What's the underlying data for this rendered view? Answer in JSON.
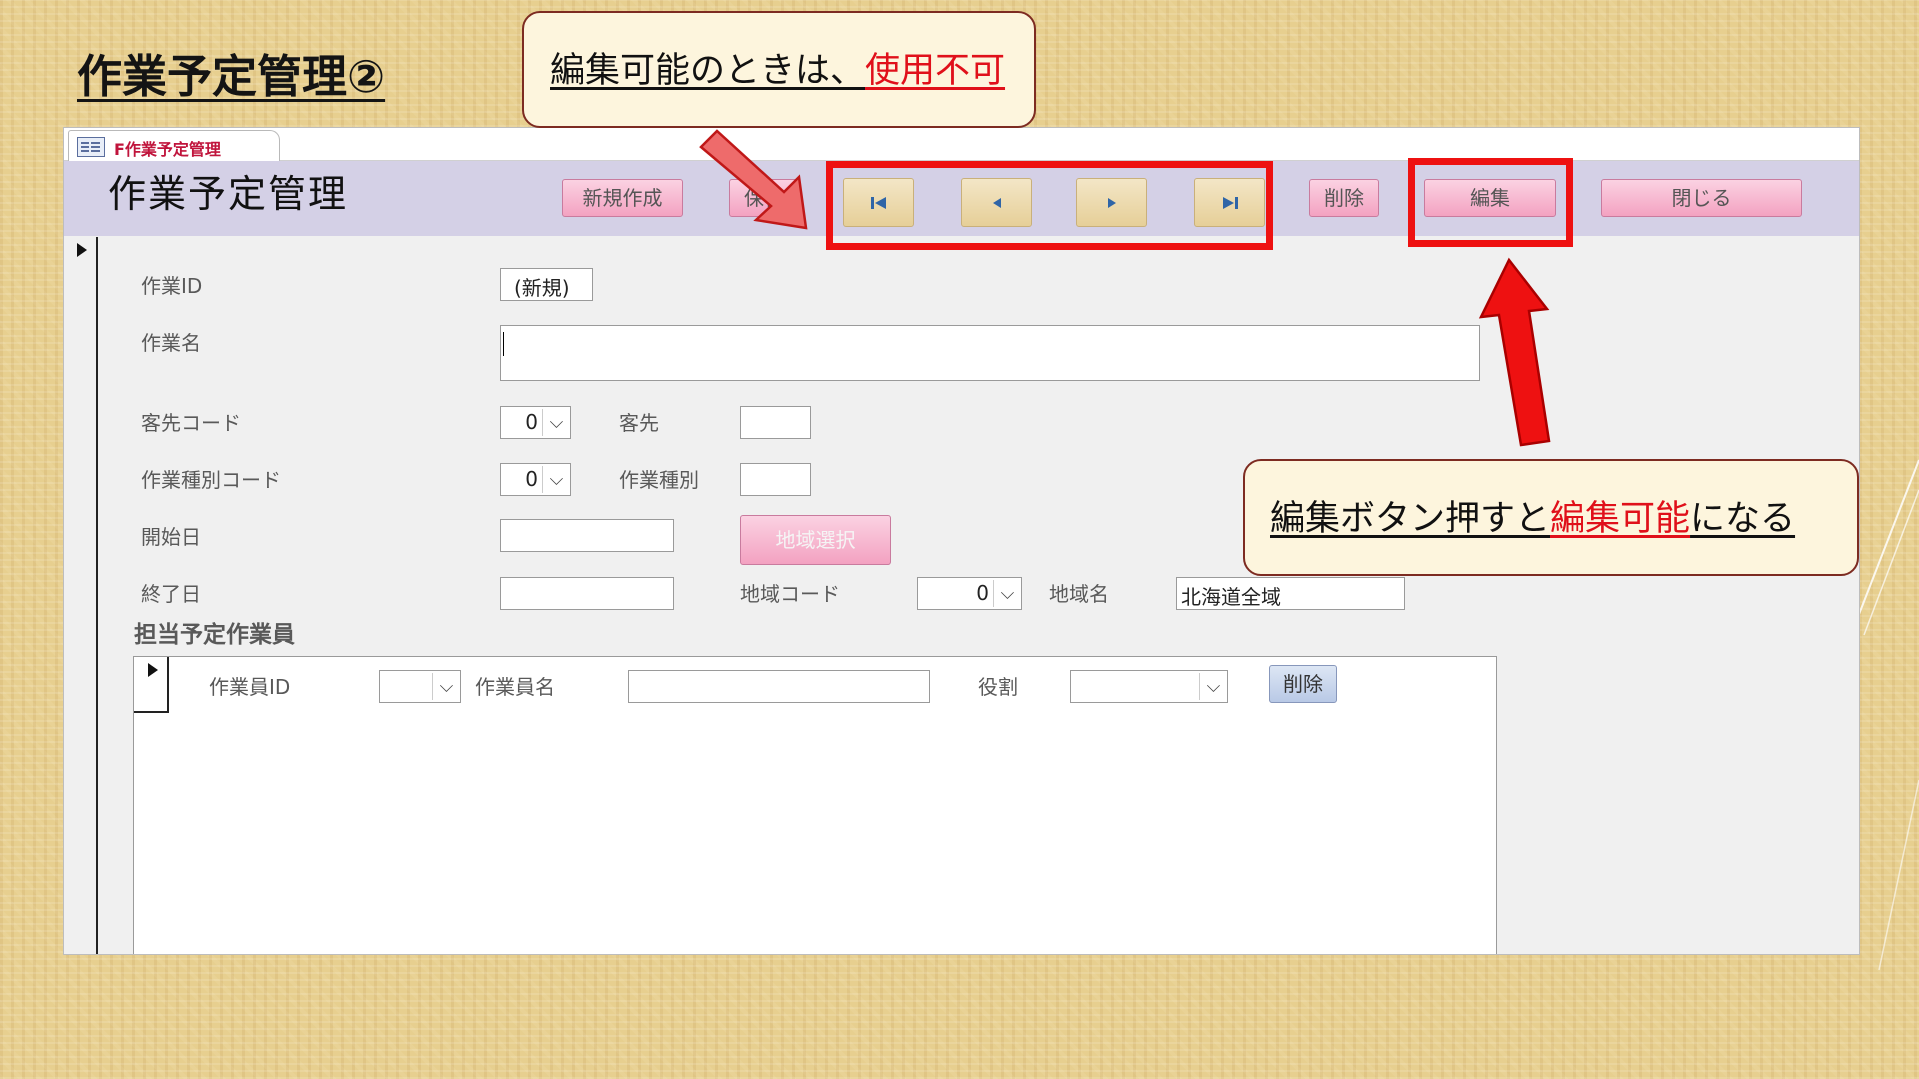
{
  "slide": {
    "title": "作業予定管理②"
  },
  "window": {
    "tab_label": "F作業予定管理",
    "form_title": "作業予定管理",
    "toolbar": {
      "new_label": "新規作成",
      "save_label": "保存",
      "first_symbol": "▶|",
      "prev_symbol": "◀",
      "next_symbol": "▶",
      "last_symbol": "▶|",
      "delete_label": "削除",
      "edit_label": "編集",
      "close_label": "閉じる"
    },
    "fields": {
      "work_id_label": "作業ID",
      "work_id_value": "(新規)",
      "work_name_label": "作業名",
      "work_name_value": "",
      "client_code_label": "客先コード",
      "client_code_value": "0",
      "client_label": "客先",
      "client_value": "",
      "work_type_code_label": "作業種別コード",
      "work_type_code_value": "0",
      "work_type_label": "作業種別",
      "work_type_value": "",
      "start_date_label": "開始日",
      "start_date_value": "",
      "region_select_label": "地域選択",
      "end_date_label": "終了日",
      "end_date_value": "",
      "region_code_label": "地域コード",
      "region_code_value": "0",
      "region_name_label": "地域名",
      "region_name_value": "北海道全域"
    },
    "subform": {
      "section_title": "担当予定作業員",
      "worker_id_label": "作業員ID",
      "worker_id_value": "",
      "worker_name_label": "作業員名",
      "worker_name_value": "",
      "role_label": "役割",
      "role_value": "",
      "delete_label": "削除"
    }
  },
  "callouts": {
    "top": {
      "text": "編集可能のときは、",
      "highlight": "使用不可"
    },
    "right": {
      "text_before": "編集ボタン押すと",
      "highlight": "編集可能",
      "text_after": "になる"
    }
  },
  "colors": {
    "highlight_red": "#ee1111",
    "header_lavender": "#d4d0e6",
    "button_pink": "#f3a2c1",
    "callout_fill": "#fdf5dd"
  }
}
